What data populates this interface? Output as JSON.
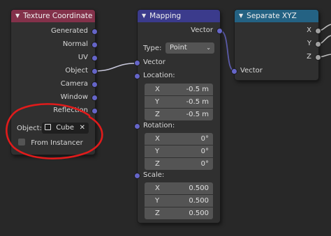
{
  "texture_coordinate": {
    "title": "Texture Coordinate",
    "outputs": [
      "Generated",
      "Normal",
      "UV",
      "Object",
      "Camera",
      "Window",
      "Reflection"
    ],
    "object_label": "Object:",
    "object_value": "Cube",
    "from_instancer": "From Instancer"
  },
  "mapping": {
    "title": "Mapping",
    "output": "Vector",
    "type_label": "Type:",
    "type_value": "Point",
    "input_vector": "Vector",
    "location": {
      "label": "Location:",
      "x": "-0.5 m",
      "y": "-0.5 m",
      "z": "-0.5 m"
    },
    "rotation": {
      "label": "Rotation:",
      "x": "0°",
      "y": "0°",
      "z": "0°"
    },
    "scale": {
      "label": "Scale:",
      "x": "0.500",
      "y": "0.500",
      "z": "0.500"
    },
    "axis_labels": [
      "X",
      "Y",
      "Z"
    ]
  },
  "separate_xyz": {
    "title": "Separate XYZ",
    "outputs": [
      "X",
      "Y",
      "Z"
    ],
    "input": "Vector"
  },
  "colors": {
    "tex_header": "#83314a",
    "map_header": "#3b3b8c",
    "sep_header": "#246283",
    "socket_vector": "#6565c8",
    "socket_float": "#a1a1a1",
    "annotation": "#e01b1b"
  }
}
